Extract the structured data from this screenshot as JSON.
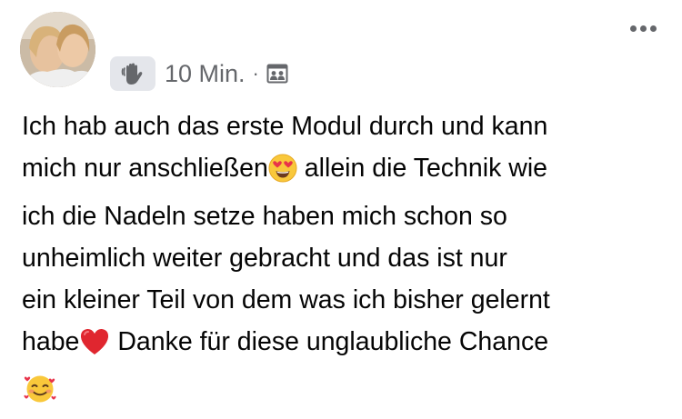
{
  "post": {
    "timestamp": "10 Min.",
    "separator": "·",
    "badge_icon": "waving-hand-icon",
    "privacy_icon": "group-privacy-icon",
    "avatar_icon": "profile-photo",
    "more_icon": "more-options-icon",
    "lines": {
      "l1": "Ich hab auch das erste Modul durch und kann",
      "l2a": "mich nur anschließen",
      "l2b": " allein die Technik wie",
      "l3": "ich die Nadeln setze haben mich schon so",
      "l4": "unheimlich weiter gebracht und das ist nur",
      "l5": "ein kleiner Teil von dem was ich bisher gelernt",
      "l6a": "habe",
      "l6b": " Danke für diese unglaubliche Chance"
    },
    "emojis": [
      "heart-eyes-emoji",
      "red-heart-emoji",
      "smiling-face-with-hearts-emoji"
    ]
  }
}
